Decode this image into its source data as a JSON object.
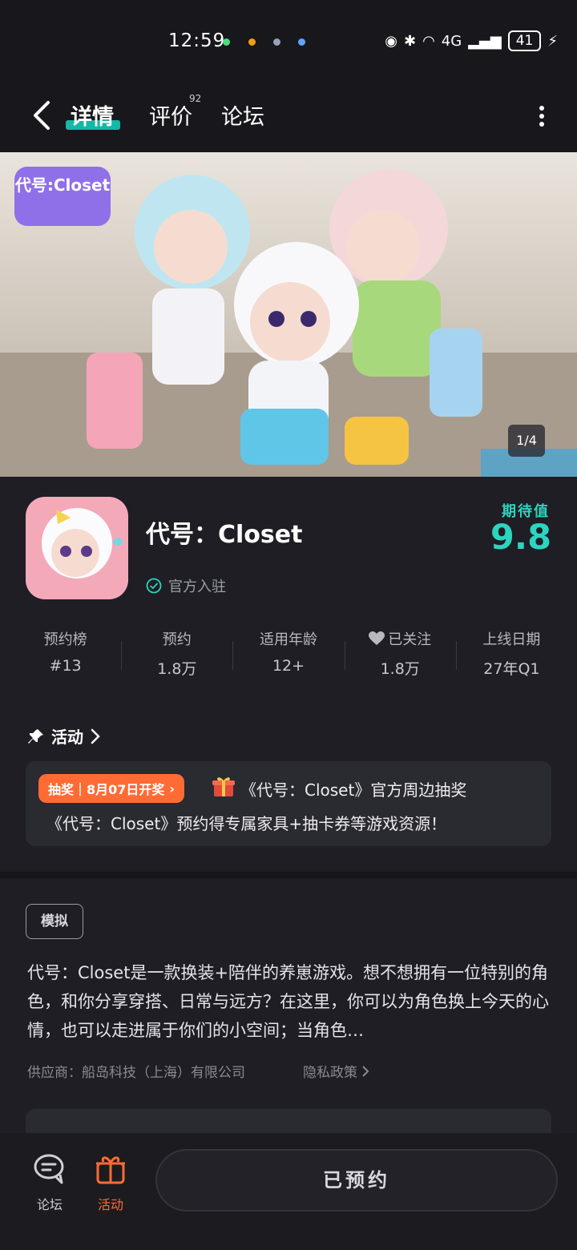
{
  "status_bar": {
    "time": "12:59",
    "battery": "41",
    "network": "4G"
  },
  "nav": {
    "tabs": [
      {
        "label": "详情"
      },
      {
        "label": "评价",
        "badge": "92"
      },
      {
        "label": "论坛"
      }
    ]
  },
  "hero": {
    "counter": "1/4",
    "logo_text": "代号:Closet"
  },
  "app": {
    "title": "代号：Closet",
    "official_label": "官方入驻",
    "expectation_label": "期待值",
    "expectation_value": "9.8"
  },
  "stats": [
    {
      "label": "预约榜",
      "value": "#13"
    },
    {
      "label": "预约",
      "value": "1.8万"
    },
    {
      "label": "适用年龄",
      "value": "12+"
    },
    {
      "label": "已关注",
      "value": "1.8万"
    },
    {
      "label": "上线日期",
      "value": "27年Q1"
    }
  ],
  "activity": {
    "section_label": "活动",
    "badge": "抽奖｜8月07日开奖",
    "line1": "《代号：Closet》官方周边抽奖",
    "line2": "《代号：Closet》预约得专属家具+抽卡券等游戏资源！"
  },
  "details": {
    "tag": "模拟",
    "description": "代号：Closet是一款换装+陪伴的养崽游戏。想不想拥有一位特别的角色，和你分享穿搭、日常与远方？在这里，你可以为角色换上今天的心情，也可以走进属于你们的小空间；当角色…",
    "supplier": "供应商：船岛科技（上海）有限公司",
    "privacy": "隐私政策"
  },
  "bottom_bar": {
    "forum_label": "论坛",
    "activity_label": "活动",
    "reserve_label": "已预约"
  },
  "colors": {
    "accent": "#2dd4bf",
    "orange": "#ff6b35",
    "background": "#1e1e24"
  }
}
